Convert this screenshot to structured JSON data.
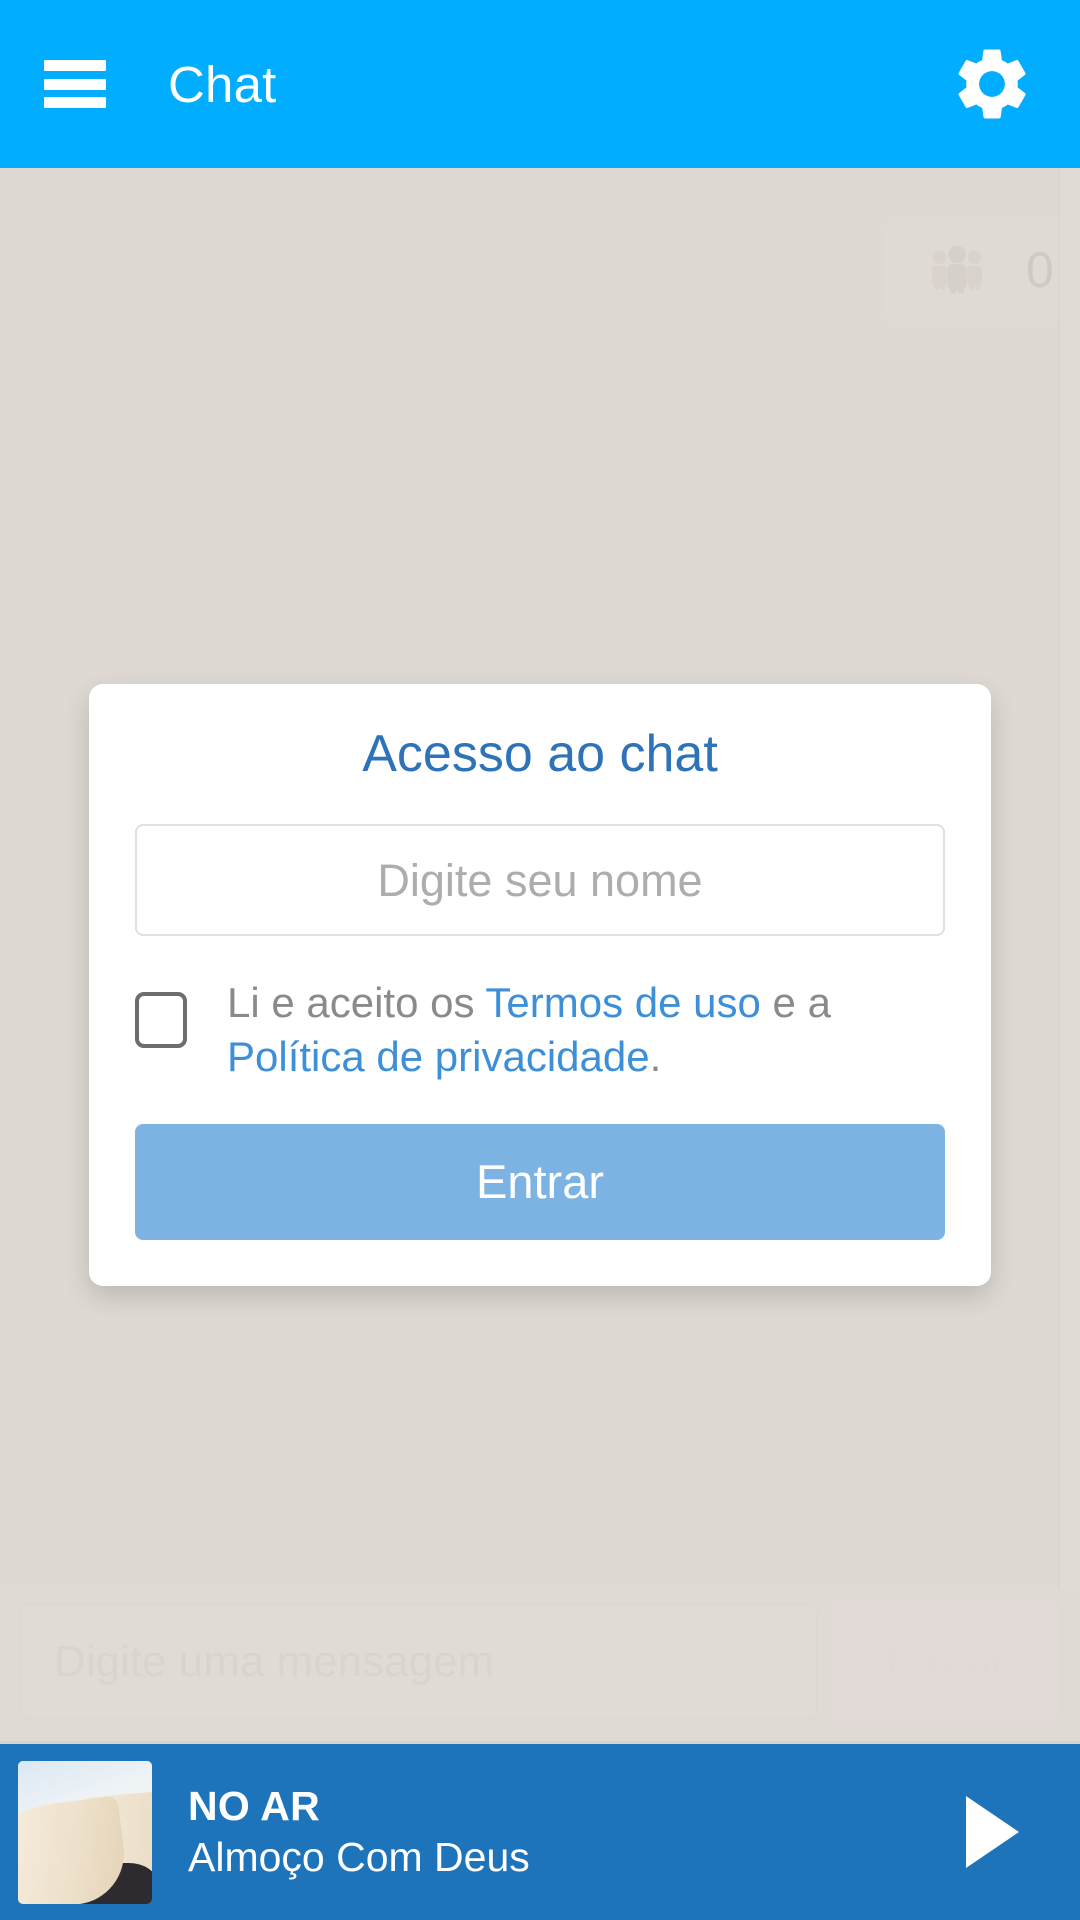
{
  "appbar": {
    "menu_icon": "hamburger-menu-icon",
    "title": "Chat",
    "settings_icon": "gear-icon"
  },
  "chat": {
    "participants": {
      "icon": "people-group-icon",
      "count": "0"
    }
  },
  "composer": {
    "message_placeholder": "Digite uma mensagem",
    "send_label": "Enviar"
  },
  "login_modal": {
    "title": "Acesso ao chat",
    "name_placeholder": "Digite seu nome",
    "name_value": "",
    "terms": {
      "prefix": "Li e aceito os ",
      "terms_link": "Termos de uso",
      "middle": " e a ",
      "privacy_link": "Política de privacidade",
      "suffix": "."
    },
    "checkbox_checked": false,
    "submit_label": "Entrar"
  },
  "player": {
    "status": "NO AR",
    "program": "Almoço Com Deus",
    "play_icon": "play-triangle-icon",
    "thumbnail_alt": "open-book-photo"
  },
  "colors": {
    "appbar": "#00adfe",
    "page_background": "#ded9d3",
    "modal_title": "#2e72b8",
    "link": "#3d8fd8",
    "submit_button": "#7db3e2",
    "player_bar": "#1d74bb"
  }
}
